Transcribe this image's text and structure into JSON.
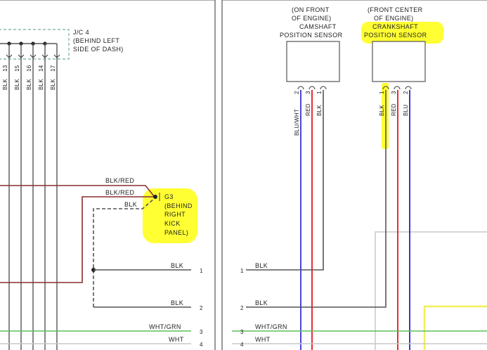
{
  "colors": {
    "black_wire": "#555555",
    "blk_red_wire": "#8b2d2d",
    "red_wire": "#e8141e",
    "blue_wire": "#2222cc",
    "blu_wht_wire": "#3b2fd6",
    "green_wire": "#5fbf5f",
    "white_wire": "#c8c8c8",
    "yellow_wire": "#f2ef5a",
    "highlight": "#ffff33"
  },
  "junction": {
    "name": "J/C 4",
    "location_line1": "(BEHIND LEFT",
    "location_line2": "SIDE OF DASH)",
    "pins": [
      "13",
      "15",
      "16",
      "14",
      "17"
    ],
    "wire_label": "BLK"
  },
  "ground": {
    "name": "G3",
    "location_line1": "(BEHIND",
    "location_line2": "RIGHT",
    "location_line3": "KICK",
    "location_line4": "PANEL)",
    "wire_top": "BLK/RED",
    "wire_mid": "BLK/RED",
    "wire_dashed": "BLK"
  },
  "camshaft_sensor": {
    "location_line1": "(ON FRONT",
    "location_line2": "OF ENGINE)",
    "name_line1": "CAMSHAFT",
    "name_line2": "POSITION SENSOR",
    "pins": [
      "2",
      "3",
      "1"
    ],
    "wires": [
      "BLU/WHT",
      "RED",
      "BLK"
    ]
  },
  "crankshaft_sensor": {
    "location_line1": "(FRONT CENTER",
    "location_line2": "OF ENGINE)",
    "name_line1": "CRANKSHAFT",
    "name_line2": "POSITION SENSOR",
    "pins": [
      "1",
      "3",
      "2"
    ],
    "wires": [
      "BLK",
      "RED",
      "BLU"
    ]
  },
  "left_rows": [
    {
      "wire": "BLK",
      "num": "1"
    },
    {
      "wire": "BLK",
      "num": "2"
    },
    {
      "wire": "WHT/GRN",
      "num": "3"
    },
    {
      "wire": "WHT",
      "num": "4"
    }
  ],
  "right_rows": [
    {
      "num": "1",
      "wire": "BLK"
    },
    {
      "num": "2",
      "wire": "BLK"
    },
    {
      "num": "3",
      "wire": "WHT/GRN"
    },
    {
      "num": "4",
      "wire": "WHT"
    }
  ]
}
